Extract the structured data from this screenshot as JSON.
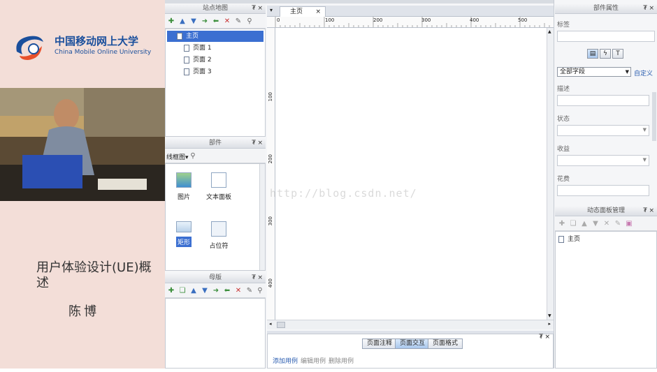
{
  "lecture": {
    "logo_cn": "中国移动网上大学",
    "logo_en": "China Mobile Online University",
    "title": "用户体验设计(UE)概述",
    "lecturer": "陈博"
  },
  "sitemap": {
    "title": "站点地图",
    "pin": "₮",
    "close": "×",
    "root": "主页",
    "pages": [
      "页面 1",
      "页面 2",
      "页面 3"
    ]
  },
  "widgets": {
    "title": "部件",
    "library": "线框图",
    "items": [
      {
        "label": "图片",
        "icon": "image-icon"
      },
      {
        "label": "文本面板",
        "icon": "text-panel-icon"
      },
      {
        "label": "矩形",
        "icon": "rectangle-icon"
      },
      {
        "label": "占位符",
        "icon": "placeholder-icon"
      }
    ]
  },
  "masters": {
    "title": "母版"
  },
  "document": {
    "tab": "主页",
    "tab_close": "×",
    "ruler_top": [
      "0",
      "100",
      "200",
      "300",
      "400",
      "500"
    ],
    "ruler_left": [
      "100",
      "200",
      "300",
      "400"
    ],
    "watermark": "http://blog.csdn.net/"
  },
  "interactions": {
    "tabs": [
      "页面注释",
      "页面交互",
      "页面格式"
    ],
    "active_tab": "页面交互",
    "links": [
      "添加用例",
      "编辑用例",
      "删除用例"
    ]
  },
  "properties": {
    "title": "部件属性",
    "label_field": "标签",
    "select": "全部字段",
    "custom": "自定义",
    "fields": [
      "描述",
      "状态",
      "收益",
      "花费"
    ]
  },
  "dynamic_panels": {
    "title": "动态面板管理",
    "root": "主页"
  },
  "colors": {
    "selection": "#3b6fd1",
    "panel_bg": "#f5f6f8",
    "lecture_bg": "#f3ded8",
    "brand_blue": "#1a4f9c"
  }
}
